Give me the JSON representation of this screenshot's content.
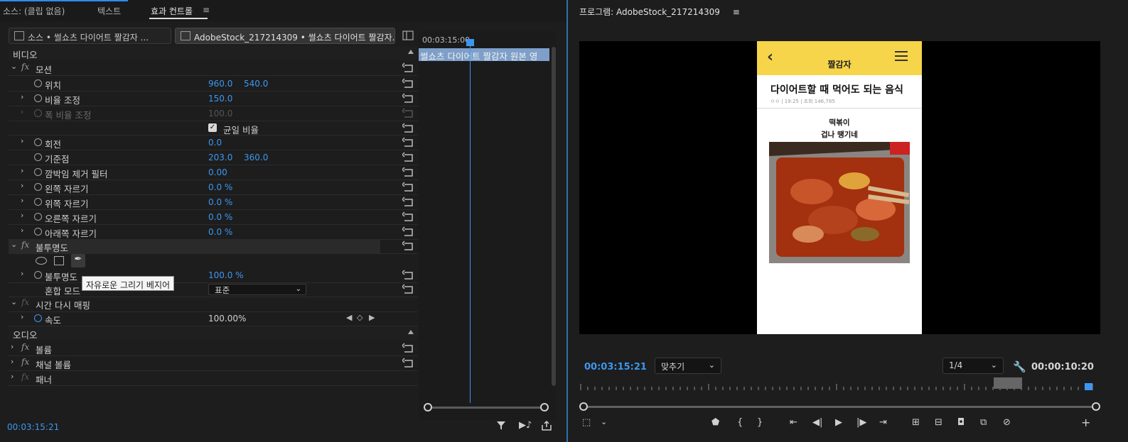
{
  "left": {
    "tabs": [
      {
        "label": "소스: (클립 없음)"
      },
      {
        "label": "텍스트"
      },
      {
        "label": "효과 컨트롤"
      }
    ],
    "menu_glyph": "≡",
    "clip_source": "소스 • 썰쇼츠 다이어트 짤감자 ...",
    "clip_sequence": "AdobeStock_217214309 • 썰쇼츠 다이어트 짤감자...",
    "timeline_time": "00:03:15:00",
    "timeline_clip": "썰쇼츠 다이어트 짤감자 원본 영",
    "video_header": "비디오",
    "audio_header": "오디오",
    "effects": {
      "motion": "모션",
      "position": {
        "label": "위치",
        "x": "960.0",
        "y": "540.0"
      },
      "scale": {
        "label": "비율 조정",
        "value": "150.0"
      },
      "scale_width": {
        "label": "폭 비율 조정",
        "value": "100.0"
      },
      "uniform_scale": "균일 비율",
      "rotation": {
        "label": "회전",
        "value": "0.0"
      },
      "anchor": {
        "label": "기준점",
        "x": "203.0",
        "y": "360.0"
      },
      "flicker": {
        "label": "깜박임 제거 필터",
        "value": "0.00"
      },
      "crop_left": {
        "label": "왼쪽 자르기",
        "value": "0.0 %"
      },
      "crop_top": {
        "label": "위쪽 자르기",
        "value": "0.0 %"
      },
      "crop_right": {
        "label": "오른쪽 자르기",
        "value": "0.0 %"
      },
      "crop_bottom": {
        "label": "아래쪽 자르기",
        "value": "0.0 %"
      },
      "opacity_group": "불투명도",
      "opacity": {
        "label": "불투명도",
        "value": "100.0 %"
      },
      "blend_mode": {
        "label": "혼합 모드",
        "value": "표준"
      },
      "time_remap": "시간 다시 매핑",
      "speed": {
        "label": "속도",
        "value": "100.00%"
      },
      "volume": "볼륨",
      "channel_volume": "채널 볼륨",
      "panner": "패너"
    },
    "tooltip": "자유로운 그리기 베지어",
    "footer_timecode": "00:03:15:21"
  },
  "program": {
    "title": "프로그램: AdobeStock_217214309",
    "menu_glyph": "≡",
    "timecode": "00:03:15:21",
    "fit": "맞추기",
    "quality": "1/4",
    "duration": "00:00:10:20",
    "phone": {
      "brand": "짤감자",
      "title": "다이어트할 때 먹어도 되는 음식",
      "meta": "ㅇㅇ | 19:25 | 조회 146,785",
      "caption1": "떡볶이",
      "caption2": "겁나 땡기네"
    }
  },
  "colors": {
    "accent": "#3c97f0",
    "header_yellow": "#f7d54a"
  }
}
